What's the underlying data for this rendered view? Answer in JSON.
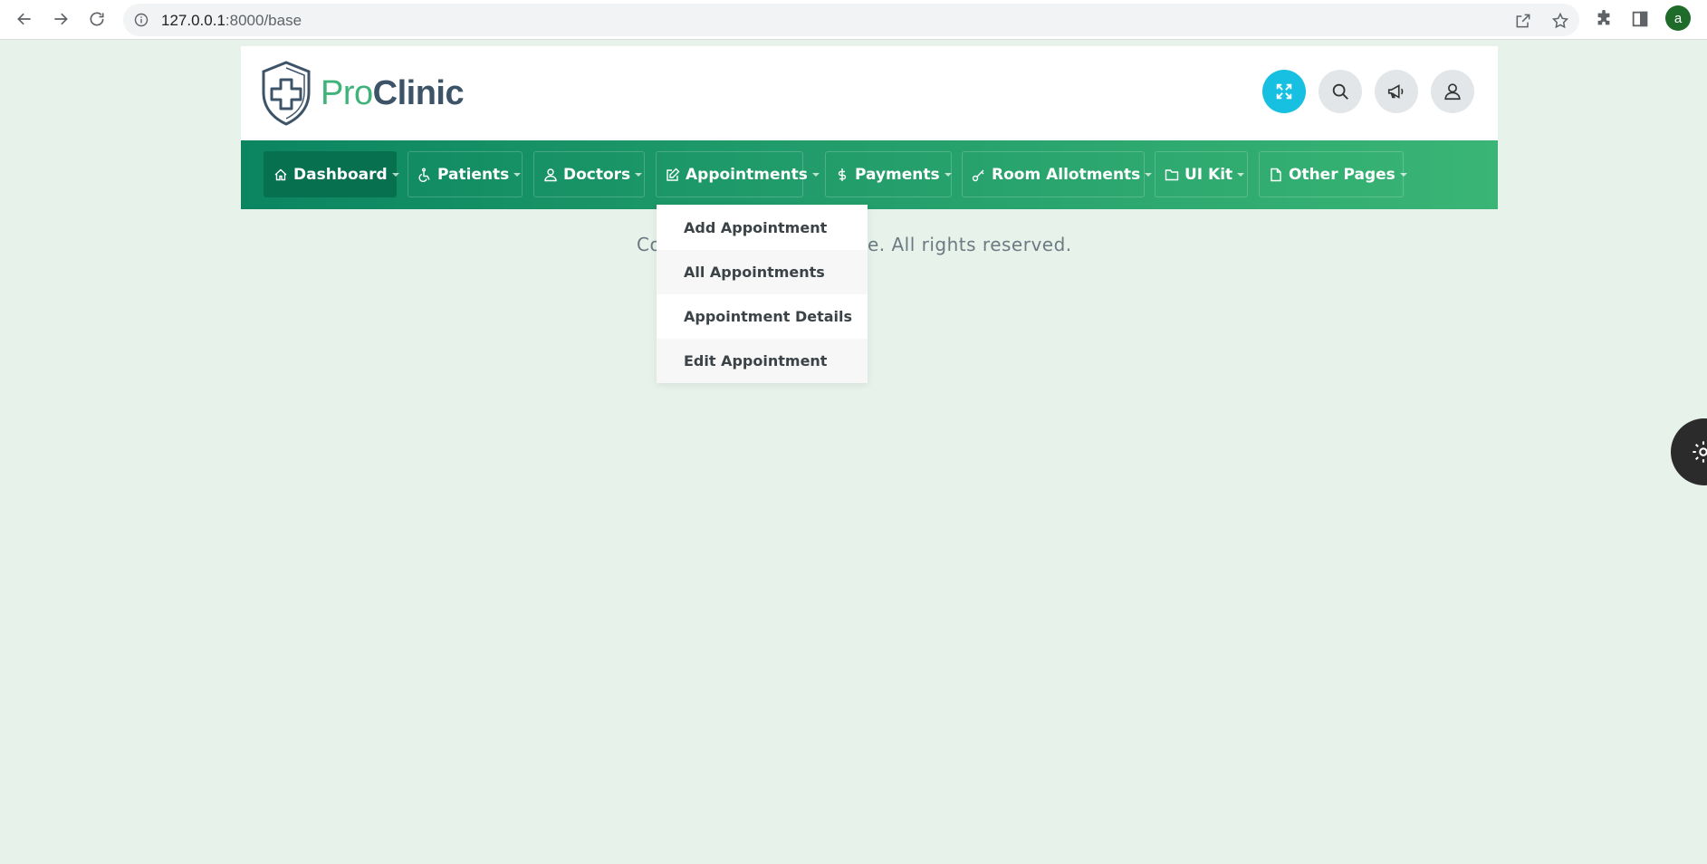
{
  "browser": {
    "url_host": "127.0.0.1",
    "url_rest": ":8000/base",
    "profile_initial": "a"
  },
  "brand": {
    "name_part1": "Pro",
    "name_part2": "Clinic",
    "accent_color": "#3fb37a",
    "secondary_color": "#3d5468"
  },
  "header_actions": [
    {
      "name": "fullscreen-icon"
    },
    {
      "name": "search-icon"
    },
    {
      "name": "megaphone-icon"
    },
    {
      "name": "user-icon"
    }
  ],
  "nav": {
    "items": [
      {
        "label": "Dashboard",
        "icon": "home-icon",
        "active": true
      },
      {
        "label": "Patients",
        "icon": "wheelchair-icon"
      },
      {
        "label": "Doctors",
        "icon": "user-icon"
      },
      {
        "label": "Appointments",
        "icon": "edit-icon"
      },
      {
        "label": "Payments",
        "icon": "dollar-icon"
      },
      {
        "label": "Room Allotments",
        "icon": "key-icon"
      },
      {
        "label": "UI Kit",
        "icon": "folder-icon"
      },
      {
        "label": "Other Pages",
        "icon": "file-icon"
      }
    ]
  },
  "dropdown": {
    "items": [
      {
        "label": "Add Appointment"
      },
      {
        "label": "All Appointments"
      },
      {
        "label": "Appointment Details"
      },
      {
        "label": "Edit Appointment"
      }
    ]
  },
  "footer": {
    "copyright_visible_left": "Co",
    "copyright_visible_right": "tcode. All rights reserved."
  }
}
